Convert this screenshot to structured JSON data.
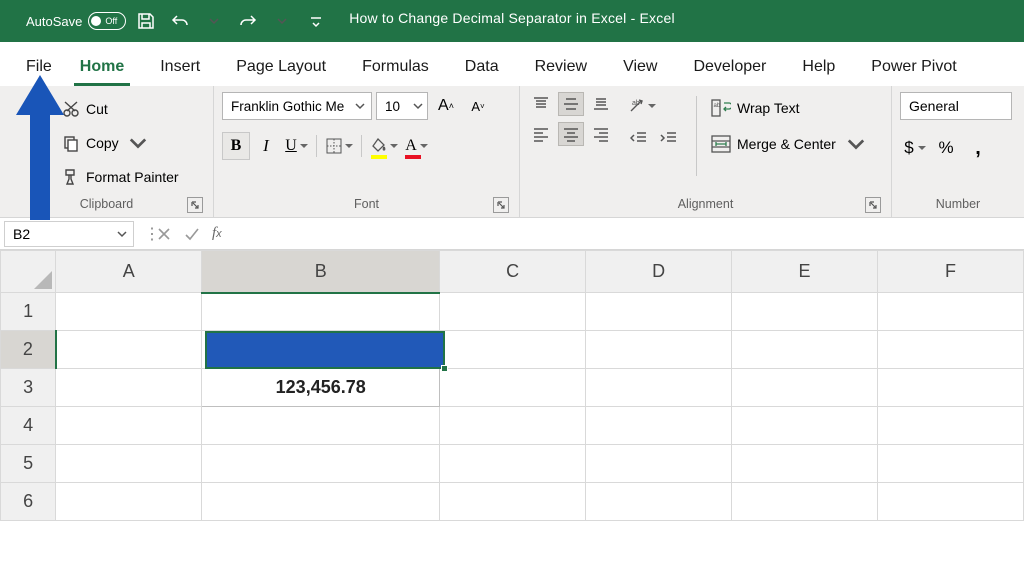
{
  "titlebar": {
    "autosave_label": "AutoSave",
    "autosave_state": "Off",
    "title": "How to Change Decimal Separator in Excel  -  Excel"
  },
  "tabs": {
    "file": "File",
    "home": "Home",
    "insert": "Insert",
    "page_layout": "Page Layout",
    "formulas": "Formulas",
    "data": "Data",
    "review": "Review",
    "view": "View",
    "developer": "Developer",
    "help": "Help",
    "power_pivot": "Power Pivot"
  },
  "ribbon": {
    "clipboard": {
      "cut": "Cut",
      "copy": "Copy",
      "format_painter": "Format Painter",
      "group_label": "Clipboard"
    },
    "font": {
      "name": "Franklin Gothic Me",
      "size": "10",
      "group_label": "Font"
    },
    "alignment": {
      "wrap_text": "Wrap Text",
      "merge_center": "Merge & Center",
      "group_label": "Alignment"
    },
    "number": {
      "format": "General",
      "group_label": "Number",
      "currency": "$",
      "percent": "%"
    }
  },
  "name_box": "B2",
  "columns": [
    "A",
    "B",
    "C",
    "D",
    "E",
    "F"
  ],
  "rows": [
    "1",
    "2",
    "3",
    "4",
    "5",
    "6"
  ],
  "cells": {
    "B3": "123,456.78"
  }
}
